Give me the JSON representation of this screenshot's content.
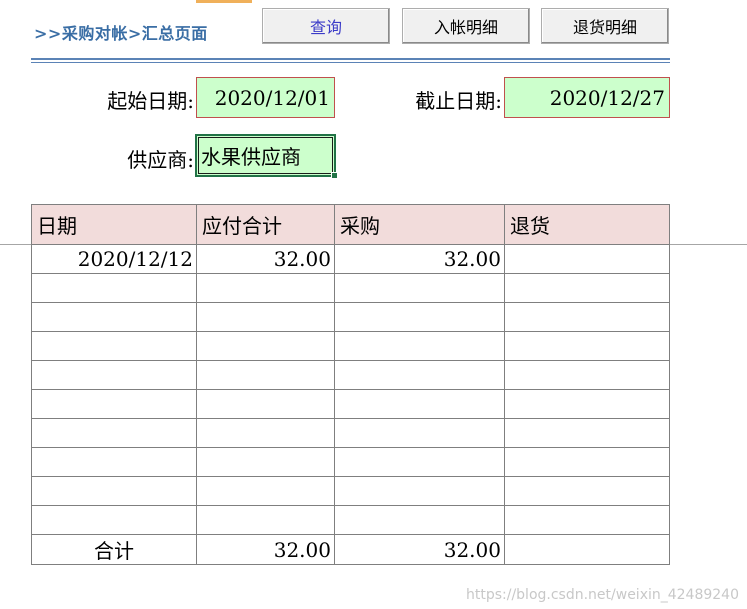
{
  "breadcrumb": ">>采购对帐>汇总页面",
  "buttons": {
    "query": "查询",
    "receipt_detail": "入帐明细",
    "return_detail": "退货明细"
  },
  "filters": {
    "start_date_label": "起始日期:",
    "start_date_value": "2020/12/01",
    "end_date_label": "截止日期:",
    "end_date_value": "2020/12/27",
    "supplier_label": "供应商:",
    "supplier_value": "水果供应商"
  },
  "table": {
    "headers": [
      "日期",
      "应付合计",
      "采购",
      "退货"
    ],
    "rows": [
      [
        "2020/12/12",
        "32.00",
        "32.00",
        ""
      ],
      [
        "",
        "",
        "",
        ""
      ],
      [
        "",
        "",
        "",
        ""
      ],
      [
        "",
        "",
        "",
        ""
      ],
      [
        "",
        "",
        "",
        ""
      ],
      [
        "",
        "",
        "",
        ""
      ],
      [
        "",
        "",
        "",
        ""
      ],
      [
        "",
        "",
        "",
        ""
      ],
      [
        "",
        "",
        "",
        ""
      ],
      [
        "",
        "",
        "",
        ""
      ]
    ],
    "total": [
      "合计",
      "32.00",
      "32.00",
      ""
    ]
  },
  "watermark": "https://blog.csdn.net/weixin_42489240",
  "colors": {
    "breadcrumb": "#3a6ea5",
    "input_fill": "#ccffcc",
    "input_border": "#c0504d",
    "header_fill": "#f2dcdb"
  }
}
